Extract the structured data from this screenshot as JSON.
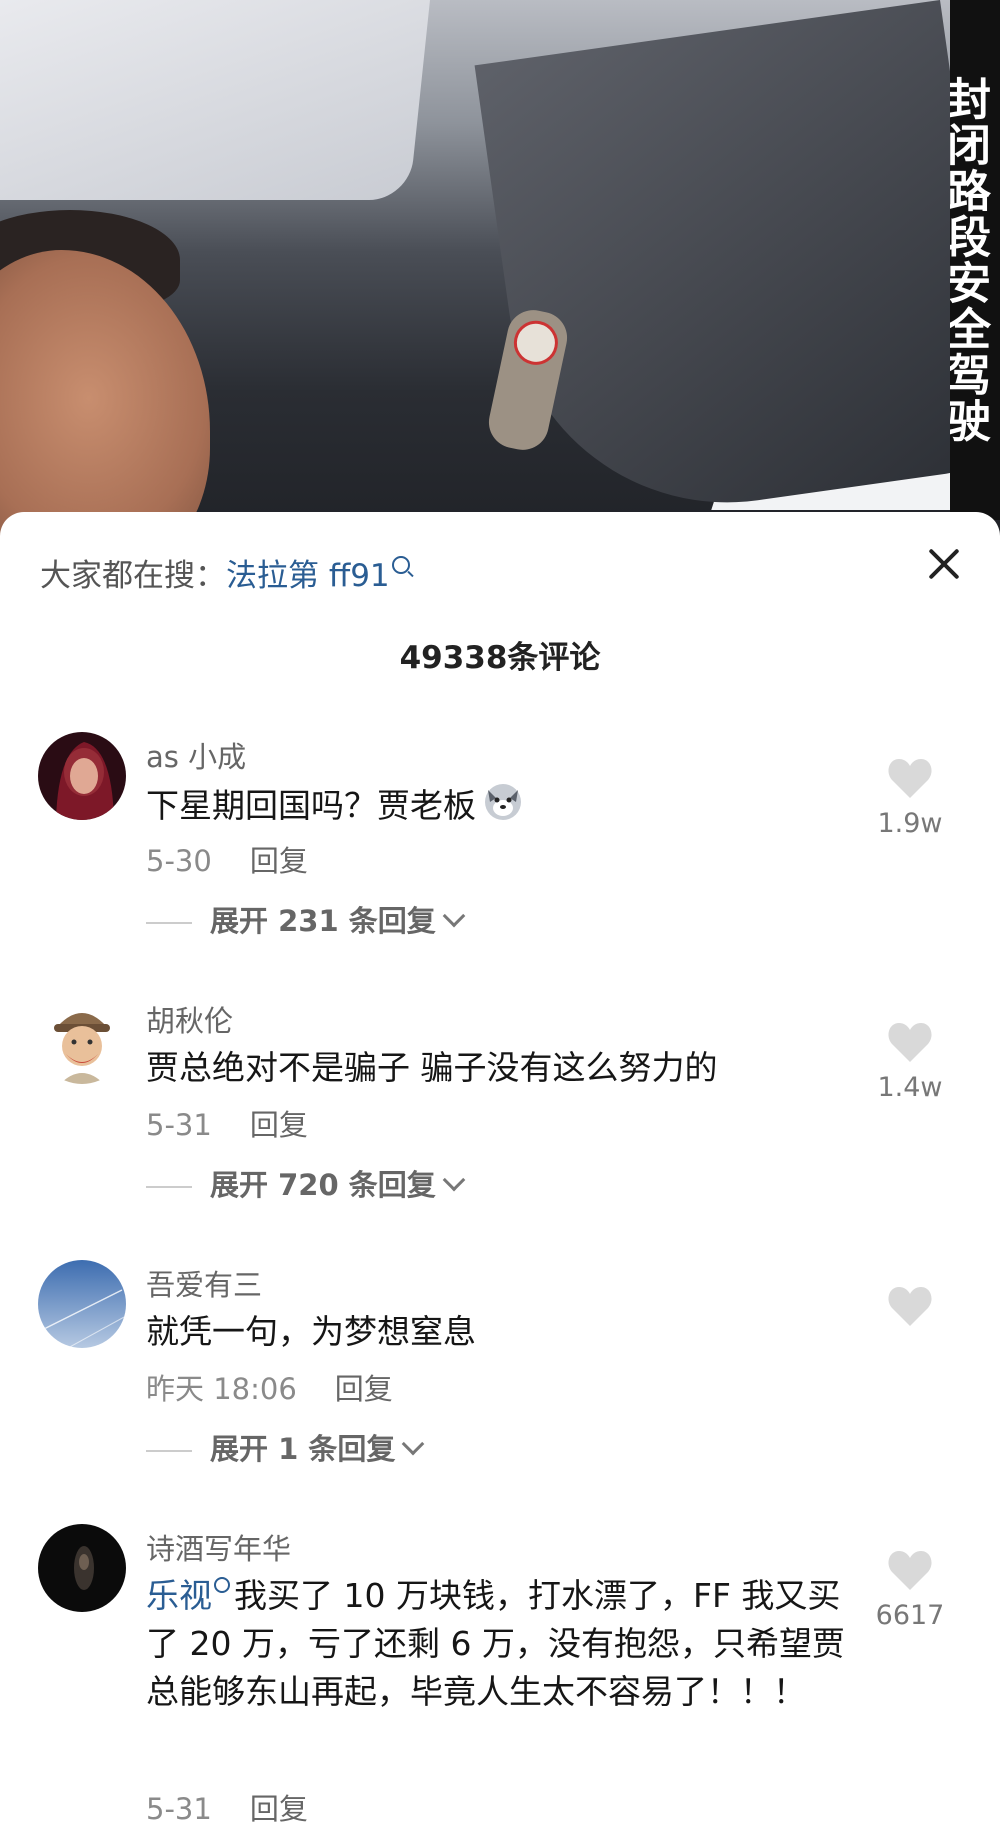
{
  "video": {
    "side_title": "封闭路段安全驾驶"
  },
  "sheet": {
    "search_prefix": "大家都在搜：",
    "search_term": "法拉第 ff91",
    "comment_count": "49338条评论"
  },
  "comments": [
    {
      "username": "as 小成",
      "text": "下星期回国吗？贾老板",
      "date": "5-30",
      "reply_label": "回复",
      "expand_label": "展开 231 条回复",
      "likes": "1.9w",
      "avatar_color": "#7b1a2e"
    },
    {
      "username": "胡秋伦",
      "text": "贾总绝对不是骗子 骗子没有这么努力的",
      "date": "5-31",
      "reply_label": "回复",
      "expand_label": "展开 720 条回复",
      "likes": "1.4w",
      "avatar_color": "#d8b08a"
    },
    {
      "username": "吾爱有三",
      "text": "就凭一句，为梦想窒息",
      "date": "昨天 18:06",
      "reply_label": "回复",
      "expand_label": "展开 1 条回复",
      "likes": "",
      "avatar_color": "#6f8fc0"
    },
    {
      "username": "诗酒写年华",
      "link_text": "乐视",
      "text": "我买了 10 万块钱，打水漂了，FF 我又买了 20 万，亏了还剩 6 万，没有抱怨，只希望贾总能够东山再起，毕竟人生太不容易了！！！",
      "date": "5-31",
      "reply_label": "回复",
      "likes": "6617",
      "avatar_color": "#111111"
    }
  ],
  "colors": {
    "link": "#2a5d93",
    "heart": "#d9d9d9"
  }
}
